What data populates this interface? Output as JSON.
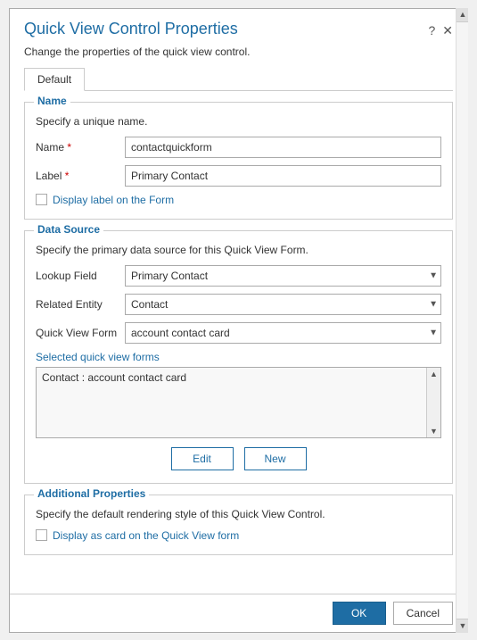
{
  "dialog": {
    "title": "Quick View Control Properties",
    "subtitle": "Change the properties of the quick view control.",
    "help_icon": "?",
    "close_icon": "✕"
  },
  "tabs": [
    {
      "label": "Default",
      "active": true
    }
  ],
  "name_section": {
    "legend": "Name",
    "description": "Specify a unique name.",
    "name_label": "Name",
    "name_required": "*",
    "name_value": "contactquickform",
    "label_label": "Label",
    "label_required": "*",
    "label_value": "Primary Contact",
    "checkbox_label": "Display label on the Form"
  },
  "datasource_section": {
    "legend": "Data Source",
    "description": "Specify the primary data source for this Quick View Form.",
    "lookup_field_label": "Lookup Field",
    "lookup_field_value": "Primary Contact",
    "lookup_field_options": [
      "Primary Contact"
    ],
    "related_entity_label": "Related Entity",
    "related_entity_value": "Contact",
    "related_entity_options": [
      "Contact"
    ],
    "quick_view_form_label": "Quick View Form",
    "quick_view_form_value": "account contact card",
    "quick_view_form_options": [
      "account contact card"
    ],
    "selected_forms_label": "Selected quick view forms",
    "selected_forms_item": "Contact : account contact card",
    "edit_button": "Edit",
    "new_button": "New"
  },
  "additional_section": {
    "legend": "Additional Properties",
    "description": "Specify the default rendering style of this Quick View Control.",
    "checkbox_label": "Display as card on the Quick View form"
  },
  "footer": {
    "ok_label": "OK",
    "cancel_label": "Cancel"
  }
}
